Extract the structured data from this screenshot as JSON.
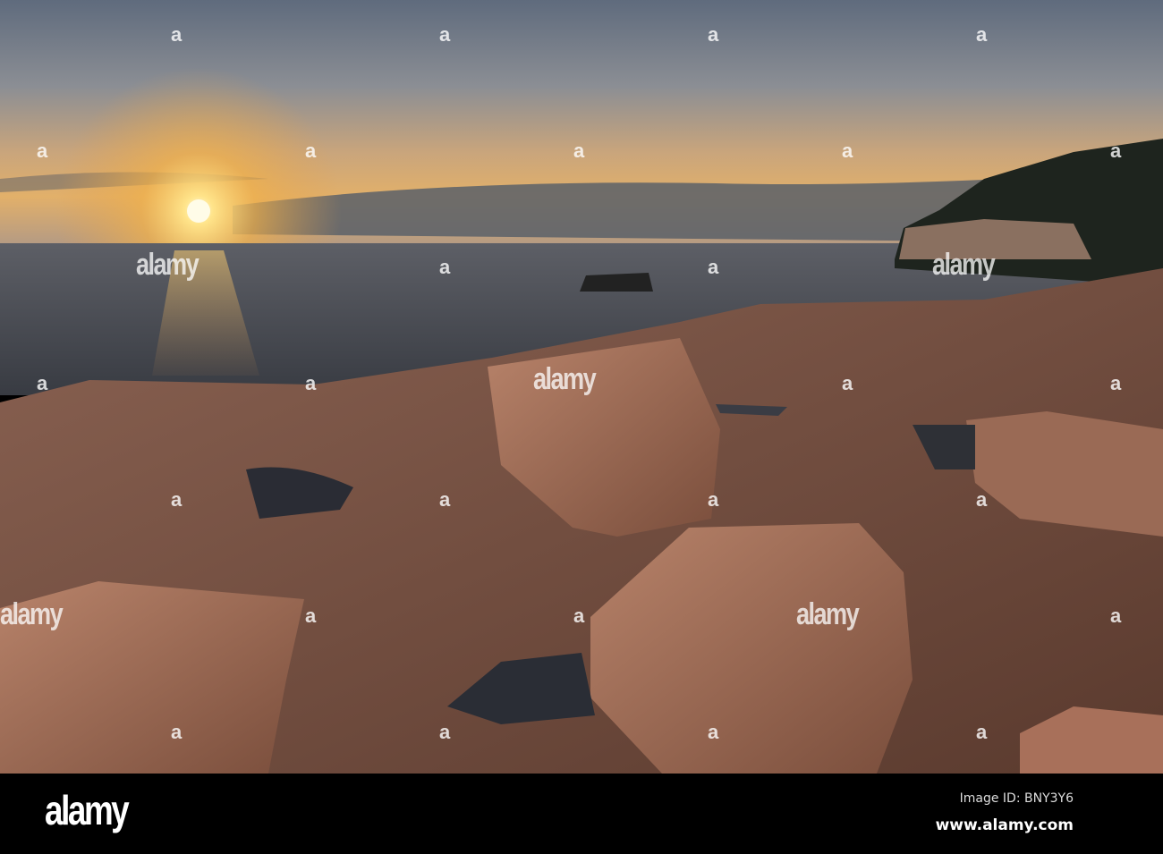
{
  "photo": {
    "subject": "sunrise-rocky-coast"
  },
  "watermark": {
    "text": "alamy",
    "glyph": "a"
  },
  "footer": {
    "logo": "alamy",
    "image_id": "Image ID: BNY3Y6",
    "website": "www.alamy.com"
  }
}
